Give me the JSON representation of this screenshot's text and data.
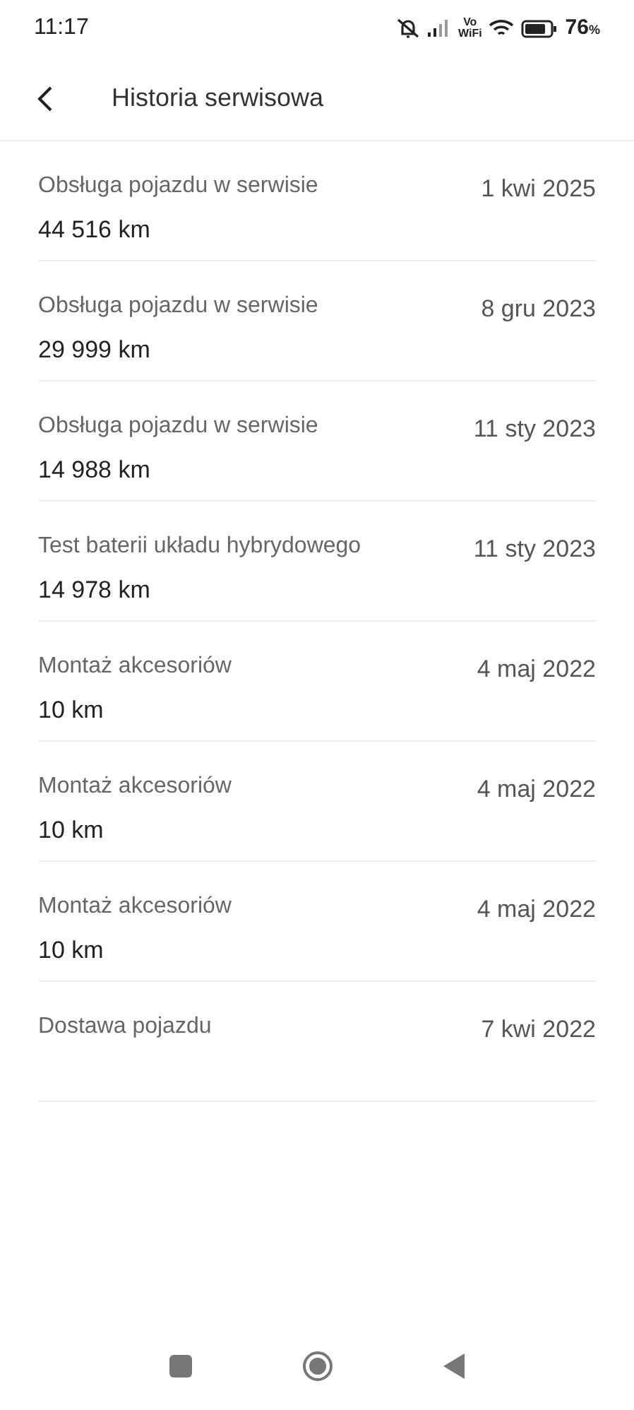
{
  "status_bar": {
    "time": "11:17",
    "vowifi_top": "Vo",
    "vowifi_bottom": "WiFi",
    "battery": "76",
    "battery_unit": "%"
  },
  "header": {
    "title": "Historia serwisowa"
  },
  "entries": [
    {
      "title": "Obsługa pojazdu w serwisie",
      "mileage": "44 516 km",
      "date": "1 kwi 2025"
    },
    {
      "title": "Obsługa pojazdu w serwisie",
      "mileage": "29 999 km",
      "date": "8 gru 2023"
    },
    {
      "title": "Obsługa pojazdu w serwisie",
      "mileage": "14 988 km",
      "date": "11 sty 2023"
    },
    {
      "title": "Test baterii układu hybrydowego",
      "mileage": "14 978 km",
      "date": "11 sty 2023"
    },
    {
      "title": "Montaż akcesoriów",
      "mileage": "10 km",
      "date": "4 maj 2022"
    },
    {
      "title": "Montaż akcesoriów",
      "mileage": "10 km",
      "date": "4 maj 2022"
    },
    {
      "title": "Montaż akcesoriów",
      "mileage": "10 km",
      "date": "4 maj 2022"
    },
    {
      "title": "Dostawa pojazdu",
      "date": "7 kwi 2022"
    }
  ]
}
